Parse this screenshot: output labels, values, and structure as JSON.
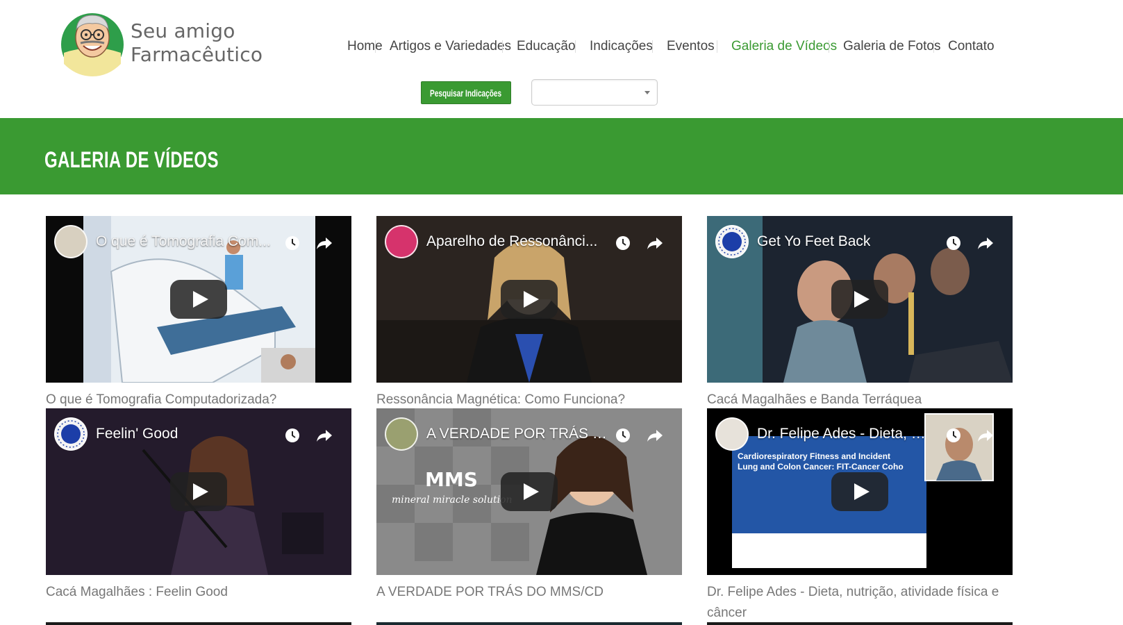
{
  "logo": {
    "line1": "Seu amigo",
    "line2": "Farmacêutico"
  },
  "nav": {
    "items": [
      {
        "label": "Home",
        "active": false
      },
      {
        "label": "Artigos e Variedades",
        "active": false
      },
      {
        "label": "Educação",
        "active": false
      },
      {
        "label": "Indicações",
        "active": false
      },
      {
        "label": "Eventos",
        "active": false
      },
      {
        "label": "Galeria de Vídeos",
        "active": true
      },
      {
        "label": "Galeria de Fotos",
        "active": false
      },
      {
        "label": "Contato",
        "active": false
      }
    ]
  },
  "search": {
    "button_label": "Pesquisar Indicações",
    "select_value": ""
  },
  "page": {
    "title": "GALERIA DE VÍDEOS"
  },
  "videos": [
    {
      "overlay_title": "O que é Tomografia Com...",
      "caption": "O que é Tomografia Computadorizada?"
    },
    {
      "overlay_title": "Aparelho de Ressonânci...",
      "caption": "Ressonância Magnética: Como Funciona?"
    },
    {
      "overlay_title": "Get Yo Feet Back",
      "caption": "Cacá Magalhães e Banda Terráquea"
    },
    {
      "overlay_title": "Feelin' Good",
      "caption": "Cacá Magalhães : Feelin Good"
    },
    {
      "overlay_title": "A VERDADE POR TRÁS D...",
      "caption": "A VERDADE POR TRÁS DO MMS/CD",
      "thumb_text": "MMS",
      "thumb_subtext": "mineral miracle solution"
    },
    {
      "overlay_title": "Dr. Felipe Ades - Dieta, n...",
      "caption": "Dr. Felipe Ades - Dieta, nutrição, atividade física e câncer",
      "thumb_text": "Cardiorespiratory Fitness and Incident Lung and Colon Cancer: FIT-Cancer Coho"
    }
  ],
  "colors": {
    "brand_green": "#3a9a32",
    "nav_text": "#444444",
    "caption_text": "#777777"
  },
  "icons": {
    "video_header": [
      "clock-icon",
      "share-icon"
    ],
    "video_center": "play-icon"
  }
}
